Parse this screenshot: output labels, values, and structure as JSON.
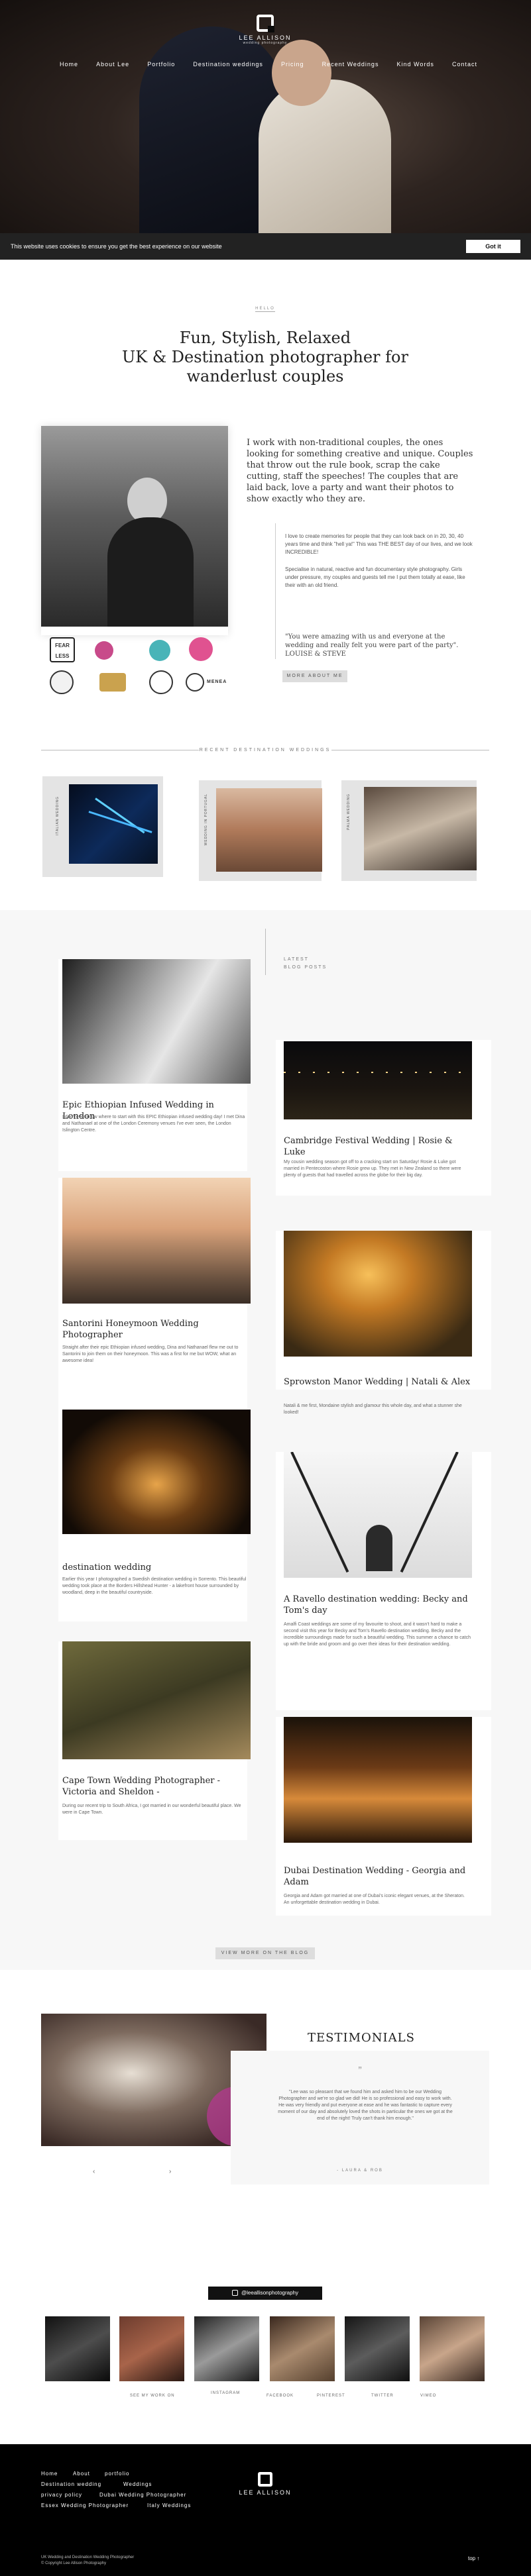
{
  "header": {
    "logo_name": "LEE ALLISON",
    "logo_sub": "wedding photography",
    "nav": [
      "Home",
      "About Lee",
      "Portfolio",
      "Destination weddings",
      "Pricing",
      "Recent Weddings",
      "Kind Words",
      "Contact"
    ]
  },
  "cookie": {
    "text": "This website uses cookies to ensure you get the best experience on our website",
    "button": "Got it"
  },
  "intro": {
    "tag": "HELLO",
    "heading_line1": "Fun, Stylish, Relaxed",
    "heading_line2": "UK & Destination photographer for",
    "heading_line3": "wanderlust couples",
    "lead": "I work with non-traditional couples, the ones looking for something creative and unique. Couples that throw out the rule book, scrap the cake cutting, staff the speeches! The couples that are laid back, love a party and want their photos to show exactly who they are.",
    "para1": "I love to create memories for people that they can look back on in 20, 30, 40 years time and think \"hell ya!\" This was THE BEST day of our lives, and we look INCREDIBLE!",
    "para2": "Specialise in natural, reactive and fun documentary style photography. Girls under pressure, my couples and guests tell me I put them totally at ease, like their with an old friend.",
    "quote": "\"You were amazing with us and everyone at the wedding and really felt you were part of the party\". LOUISE & STEVE",
    "button": "MORE ABOUT ME"
  },
  "badges": [
    "FEAR LESS",
    "WPJA",
    "Rock n Roll Bride",
    "Love My Dress",
    "Best of 2019",
    "Fearless Award",
    "Nominated",
    "Award",
    "MENEA"
  ],
  "destinations": {
    "heading": "RECENT DESTINATION WEDDINGS",
    "items": [
      "ITALIAN WEDDING",
      "WEDDING IN PORTUGAL",
      "PALMA WEDDING"
    ]
  },
  "blog": {
    "tag1": "LATEST",
    "tag2": "BLOG POSTS",
    "posts": [
      {
        "title": "Epic Ethiopian Infused Wedding in London",
        "text": "I don't ever know where to start with this EPIC Ethiopian infused wedding day! I met Dina and Nathanael at one of the London Ceremony venues I've ever seen, the London Islington Centre."
      },
      {
        "title": "Cambridge Festival Wedding | Rosie & Luke",
        "text": "My cousin wedding season got off to a cracking start on Saturday! Rosie & Luke got married in Pentecoston where Rosie grew up. They met in New Zealand so there were plenty of guests that had travelled across the globe for their big day."
      },
      {
        "title": "Santorini Honeymoon Wedding Photographer",
        "text": "Straight after their epic Ethiopian infused wedding, Dina and Nathanael flew me out to Santorini to join them on their honeymoon. This was a first for me but WOW, what an awesome idea!"
      },
      {
        "title": "Sprowston Manor Wedding | Natali & Alex",
        "text": "Natali & me first, Mondaine stylish and glamour this whole day, and what a stunner she looked!"
      },
      {
        "title": "destination wedding",
        "text": "Earlier this year I photographed a Swedish destination wedding in Sorrento. This beautiful wedding took place at the Borders Hillshead Hunter - a lakefront house surrounded by woodland, deep in the beautiful countryside."
      },
      {
        "title": "A Ravello destination wedding: Becky and Tom's day",
        "text": "Amalfi Coast weddings are some of my favourite to shoot, and it wasn't hard to make a second visit this year for Becky and Tom's Ravello destination wedding. Becky and the incredible surroundings made for such a beautiful wedding. This summer a chance to catch up with the bride and groom and go over their ideas for their destination wedding."
      },
      {
        "title": "Cape Town Wedding Photographer - Victoria and Sheldon -",
        "text": "During our recent trip to South Africa, I got married in our wonderful beautiful place. We were in Cape Town."
      },
      {
        "title": "Dubai Destination Wedding - Georgia and Adam",
        "text": "Georgia and Adam got married at one of Dubai's iconic elegant venues, at the Sheraton. An unforgettable destination wedding in Dubai."
      }
    ],
    "view_more": "VIEW MORE ON THE BLOG"
  },
  "testimonials": {
    "heading": "TESTIMONIALS",
    "quote": "\"Lee was so pleasant that we found him and asked him to be our Wedding Photographer and we're so glad we did! He is so professional and easy to work with. He was very friendly and put everyone at ease and he was fantastic to capture every moment of our day and absolutely loved the shots in particular the ones we got at the end of the night! Truly can't thank him enough.\"",
    "author": "- LAURA & ROB"
  },
  "instagram": {
    "handle": "@leeallisonphotography",
    "labels": [
      "SEE MY WORK ON",
      "INSTAGRAM",
      "FACEBOOK",
      "PINTEREST",
      "TWITTER",
      "VIMEO"
    ]
  },
  "footer": {
    "links": [
      "Home",
      "About",
      "portfolio",
      "Destination wedding",
      "Weddings",
      "privacy policy",
      "Dubai Wedding Photographer",
      "Essex Wedding Photographer",
      "Italy Weddings"
    ],
    "logo_name": "LEE ALLISON",
    "copyright_line1": "UK Wedding and Destination Wedding Photographer",
    "copyright_line2": "© Copyright Lee Allison Photography",
    "top": "top"
  },
  "colors": {
    "accent": "#000000",
    "page_bg": "#ffffff",
    "section_bg": "#f7f7f7",
    "button_grey": "#dddddd"
  }
}
